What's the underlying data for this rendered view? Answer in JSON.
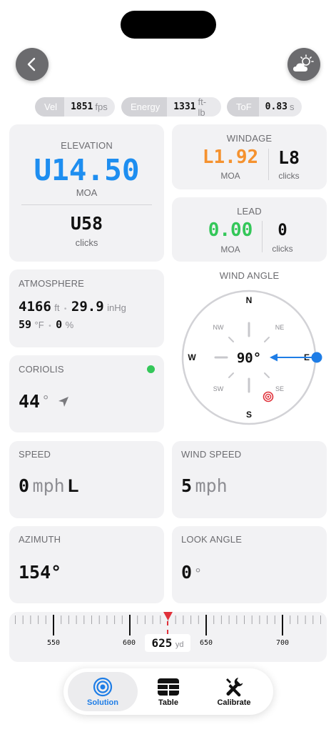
{
  "stats": {
    "velocity": {
      "label": "Vel",
      "value": "1851",
      "unit": "fps"
    },
    "energy": {
      "label": "Energy",
      "value": "1331",
      "unit": "ft-lb"
    },
    "tof": {
      "label": "ToF",
      "value": "0.83",
      "unit": "s"
    }
  },
  "elevation": {
    "title": "ELEVATION",
    "value": "U14.50",
    "unit": "MOA",
    "clicks": "U58",
    "clicks_label": "clicks",
    "color": "#1e8ef0"
  },
  "windage": {
    "title": "WINDAGE",
    "value": "L1.92",
    "unit": "MOA",
    "clicks": "L8",
    "clicks_label": "clicks",
    "color": "#f5922f"
  },
  "lead": {
    "title": "LEAD",
    "value": "0.00",
    "unit": "MOA",
    "clicks": "0",
    "clicks_label": "clicks",
    "color": "#34c759"
  },
  "atmosphere": {
    "title": "ATMOSPHERE",
    "altitude": "4166",
    "altitude_unit": "ft",
    "pressure": "29.9",
    "pressure_unit": "inHg",
    "temperature": "59",
    "temperature_unit": "°F",
    "humidity": "0",
    "humidity_unit": "%"
  },
  "coriolis": {
    "title": "CORIOLIS",
    "value": "44",
    "unit": "°",
    "status_color": "#34c759"
  },
  "wind_angle": {
    "title": "WIND ANGLE",
    "value": "90°",
    "n": "N",
    "ne": "NE",
    "e": "E",
    "se": "SE",
    "s": "S",
    "sw": "SW",
    "w": "W",
    "nw": "NW",
    "arrow_color": "#1e7de6",
    "target_color": "#e0313a"
  },
  "speed": {
    "title": "SPEED",
    "value": "0",
    "unit": "mph",
    "direction": "L"
  },
  "wind_speed": {
    "title": "WIND SPEED",
    "value": "5",
    "unit": "mph"
  },
  "azimuth": {
    "title": "AZIMUTH",
    "value": "154°"
  },
  "look_angle": {
    "title": "LOOK ANGLE",
    "value": "0",
    "unit": "°"
  },
  "range": {
    "ticks": [
      "550",
      "600",
      "650",
      "700"
    ],
    "value": "625",
    "unit": "yd",
    "marker_color": "#e0313a"
  },
  "tabs": {
    "solution": "Solution",
    "table": "Table",
    "calibrate": "Calibrate",
    "active_color": "#1e7de6"
  }
}
